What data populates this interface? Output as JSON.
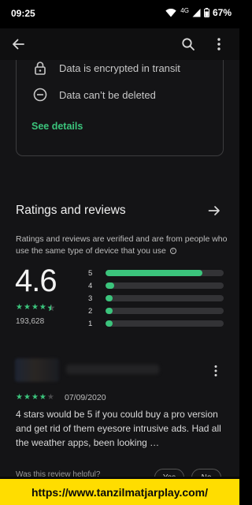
{
  "status_bar": {
    "time": "09:25",
    "network": "4G",
    "battery": "67%"
  },
  "app_bar": {
    "back_icon": "arrow-back-icon",
    "search_icon": "search-icon",
    "more_icon": "more-vert-icon"
  },
  "data_safety": {
    "items": [
      {
        "icon": "lock-icon",
        "label": "Data is encrypted in transit"
      },
      {
        "icon": "delete-blocked-icon",
        "label": "Data can’t be deleted"
      }
    ],
    "see_details": "See details"
  },
  "ratings": {
    "title": "Ratings and reviews",
    "note": "Ratings and reviews are verified and are from people who use the same type of device that you use",
    "score": "4.6",
    "stars": 4.5,
    "count": "193,628",
    "distribution": [
      {
        "label": "5",
        "fraction": 0.82
      },
      {
        "label": "4",
        "fraction": 0.07
      },
      {
        "label": "3",
        "fraction": 0.05
      },
      {
        "label": "2",
        "fraction": 0.04
      },
      {
        "label": "1",
        "fraction": 0.06
      }
    ]
  },
  "review": {
    "stars": 4,
    "date": "07/09/2020",
    "body": "4 stars would be 5 if you could buy a pro version and get rid of them eyesore intrusive ads. Had all the weather apps, been looking …",
    "helpful_question": "Was this review helpful?",
    "yes_label": "Yes",
    "no_label": "No"
  },
  "watermark": {
    "text": "https://www.tanzilmatjarplay.com/",
    "background": "#ffdd00"
  },
  "colors": {
    "accent": "#3bc47c",
    "background": "#141416",
    "track": "#333336"
  }
}
